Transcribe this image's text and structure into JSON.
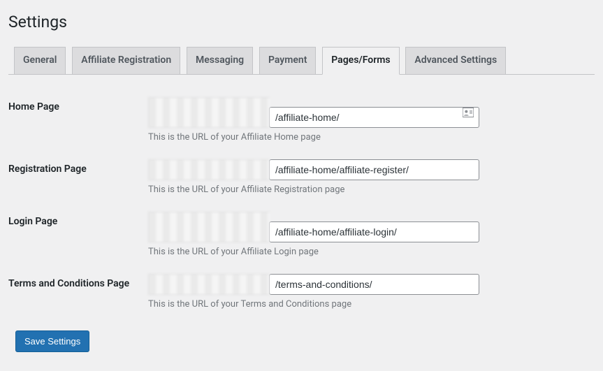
{
  "page": {
    "title": "Settings"
  },
  "tabs": [
    {
      "label": "General"
    },
    {
      "label": "Affiliate Registration"
    },
    {
      "label": "Messaging"
    },
    {
      "label": "Payment"
    },
    {
      "label": "Pages/Forms",
      "active": true
    },
    {
      "label": "Advanced Settings"
    }
  ],
  "fields": {
    "home": {
      "label": "Home Page",
      "value": "/affiliate-home/",
      "helper": "This is the URL of your Affiliate Home page"
    },
    "registration": {
      "label": "Registration Page",
      "value": "/affiliate-home/affiliate-register/",
      "helper": "This is the URL of your Affiliate Registration page"
    },
    "login": {
      "label": "Login Page",
      "value": "/affiliate-home/affiliate-login/",
      "helper": "This is the URL of your Affiliate Login page"
    },
    "terms": {
      "label": "Terms and Conditions Page",
      "value": "/terms-and-conditions/",
      "helper": "This is the URL of your Terms and Conditions page"
    }
  },
  "actions": {
    "save": "Save Settings"
  }
}
